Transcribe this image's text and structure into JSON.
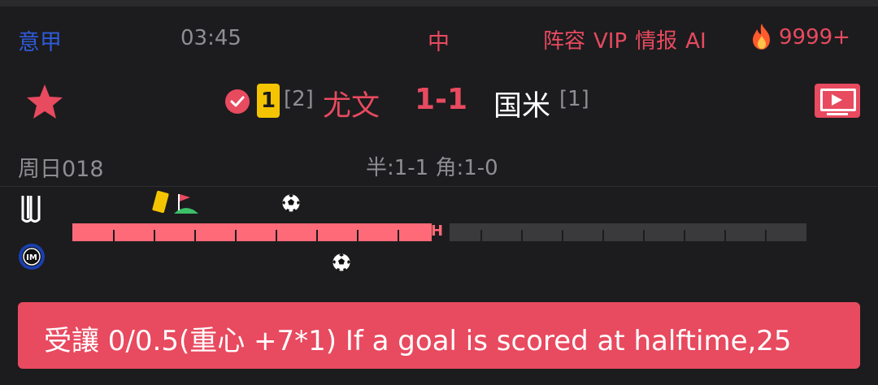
{
  "header": {
    "league": "意甲",
    "match_time": "03:45",
    "status": "中",
    "links": [
      "阵容",
      "VIP",
      "情报",
      "AI"
    ],
    "hot_count": "9999+"
  },
  "match": {
    "home_yellow_cards": "1",
    "home_rank": "[2]",
    "home_team": "尤文",
    "score": "1-1",
    "away_team": "国米",
    "away_rank": "[1]"
  },
  "info": {
    "match_number": "周日018",
    "stats": "半:1-1 角:1-0"
  },
  "timeline": {
    "progress": 0.49,
    "half_marker": "H",
    "segments": 18
  },
  "banner": {
    "text": "受讓 0/0.5(重心 +7*1) If a goal is scored at halftime,25"
  },
  "colors": {
    "accent": "#e84a5f",
    "league_blue": "#2f5bd9",
    "card_yellow": "#f5c400",
    "timeline_played": "#ff6a78",
    "timeline_future": "#3a3a3c",
    "background": "#1c1c1e"
  },
  "icons": {
    "favorite": "star-icon",
    "verified": "check-circle-icon",
    "live": "tv-icon",
    "hot": "fire-icon",
    "yellow_card": "yellow-card-icon",
    "corner": "corner-flag-icon",
    "goal": "soccer-ball-icon"
  }
}
